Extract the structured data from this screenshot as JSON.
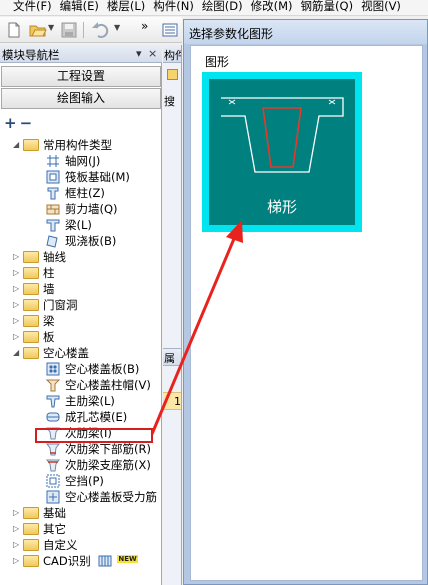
{
  "menubar": {
    "items": [
      "文件(F)",
      "编辑(E)",
      "楼层(L)",
      "构件(N)",
      "绘图(D)",
      "修改(M)",
      "钢筋量(Q)",
      "视图(V)"
    ]
  },
  "toolbar": {
    "more": "»"
  },
  "nav": {
    "title": "模块导航栏",
    "pin": "▾",
    "close": "×",
    "project_settings": "工程设置",
    "drawing_input": "绘图输入",
    "tree_tools": [
      "+",
      "−"
    ],
    "tree": [
      {
        "label": "常用构件类型",
        "icon": "folder-icon"
      },
      {
        "label": "轴网(J)",
        "icon": "grid-icon"
      },
      {
        "label": "筏板基础(M)",
        "icon": "raft-foundation-icon"
      },
      {
        "label": "框柱(Z)",
        "icon": "frame-column-icon"
      },
      {
        "label": "剪力墙(Q)",
        "icon": "shear-wall-icon"
      },
      {
        "label": "梁(L)",
        "icon": "beam-icon"
      },
      {
        "label": "现浇板(B)",
        "icon": "cast-slab-icon"
      },
      {
        "label": "轴线",
        "icon": "folder-icon"
      },
      {
        "label": "柱",
        "icon": "folder-icon"
      },
      {
        "label": "墙",
        "icon": "folder-icon"
      },
      {
        "label": "门窗洞",
        "icon": "folder-icon"
      },
      {
        "label": "梁",
        "icon": "folder-icon"
      },
      {
        "label": "板",
        "icon": "folder-icon"
      },
      {
        "label": "空心楼盖",
        "icon": "folder-icon"
      },
      {
        "label": "空心楼盖板(B)",
        "icon": "hollow-slab-icon"
      },
      {
        "label": "空心楼盖柱帽(V)",
        "icon": "column-cap-icon"
      },
      {
        "label": "主肋梁(L)",
        "icon": "main-rib-beam-icon"
      },
      {
        "label": "成孔芯模(E)",
        "icon": "core-mold-icon"
      },
      {
        "label": "次肋梁(I)",
        "icon": "secondary-rib-beam-icon"
      },
      {
        "label": "次肋梁下部筋(R)",
        "icon": "rib-bottom-rebar-icon"
      },
      {
        "label": "次肋梁支座筋(X)",
        "icon": "rib-support-rebar-icon"
      },
      {
        "label": "空挡(P)",
        "icon": "gap-icon"
      },
      {
        "label": "空心楼盖板受力筋",
        "icon": "stress-rebar-icon"
      },
      {
        "label": "基础",
        "icon": "folder-icon"
      },
      {
        "label": "其它",
        "icon": "folder-icon"
      },
      {
        "label": "自定义",
        "icon": "folder-icon"
      },
      {
        "label": "CAD识别",
        "icon": "folder-icon"
      }
    ],
    "new_badge": "NEW"
  },
  "middle": {
    "header": "构件",
    "search": "搜",
    "properties": "属",
    "row_number": "1"
  },
  "dialog": {
    "title": "选择参数化图形",
    "group_label": "图形",
    "shape_label": "梯形"
  },
  "colors": {
    "highlight": "#d21f1f",
    "shape_border": "#00e4f0",
    "shape_fill": "#00807f"
  }
}
